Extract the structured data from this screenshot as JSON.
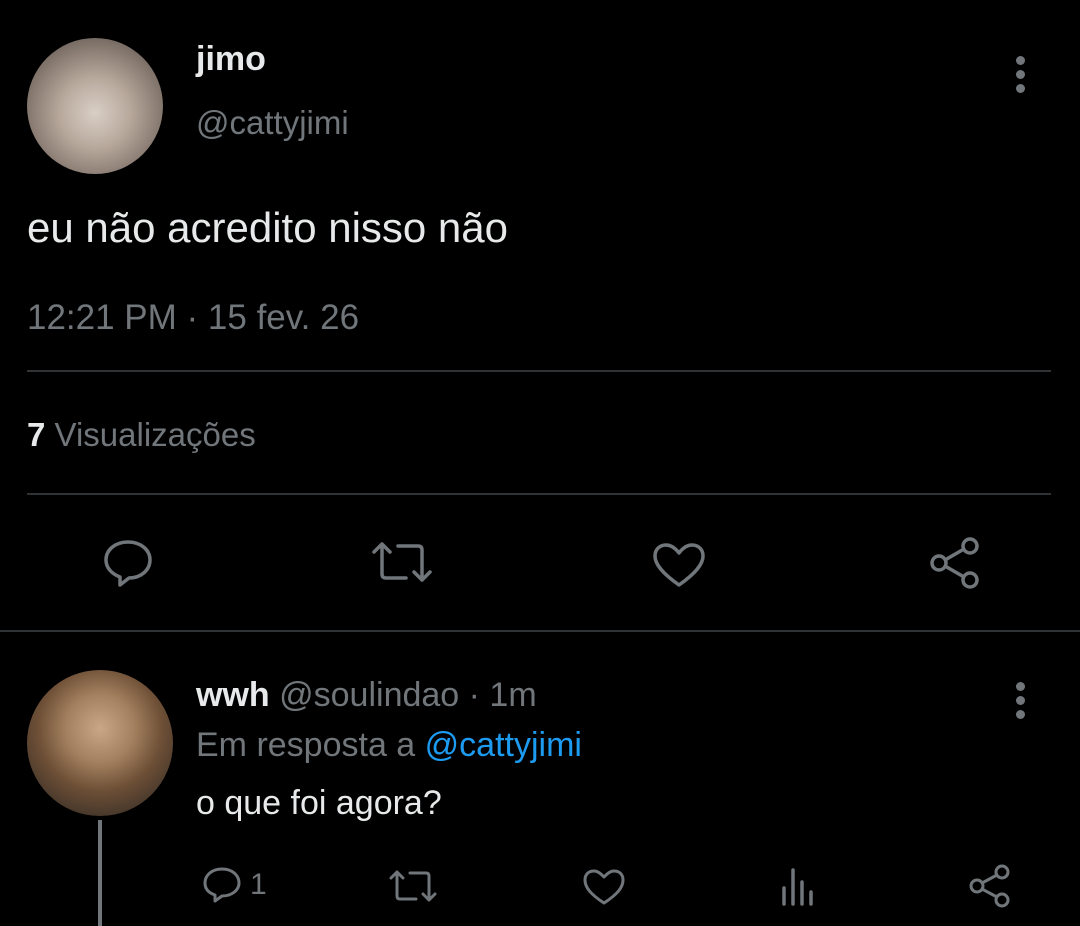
{
  "tweet": {
    "author_name": "jimo",
    "author_handle": "@cattyjimi",
    "text": "eu não acredito nisso não",
    "timestamp": "12:21 PM · 15 fev. 26",
    "views_count": "7",
    "views_label": "Visualizações",
    "actions": [
      "reply-icon",
      "retweet-icon",
      "like-icon",
      "share-icon"
    ]
  },
  "reply": {
    "author_name": "wwh",
    "author_handle": "@soulindao",
    "time": "· 1m",
    "reply_prefix": "Em resposta a",
    "reply_to": "@cattyjimi",
    "text": "o que foi agora?",
    "reply_count": "1",
    "actions": [
      "reply-icon",
      "retweet-icon",
      "like-icon",
      "views-icon",
      "share-icon"
    ]
  },
  "colors": {
    "background": "#000000",
    "text": "#e7e9ea",
    "muted": "#71767b",
    "link": "#1d9bf0",
    "divider": "#2f3336"
  }
}
